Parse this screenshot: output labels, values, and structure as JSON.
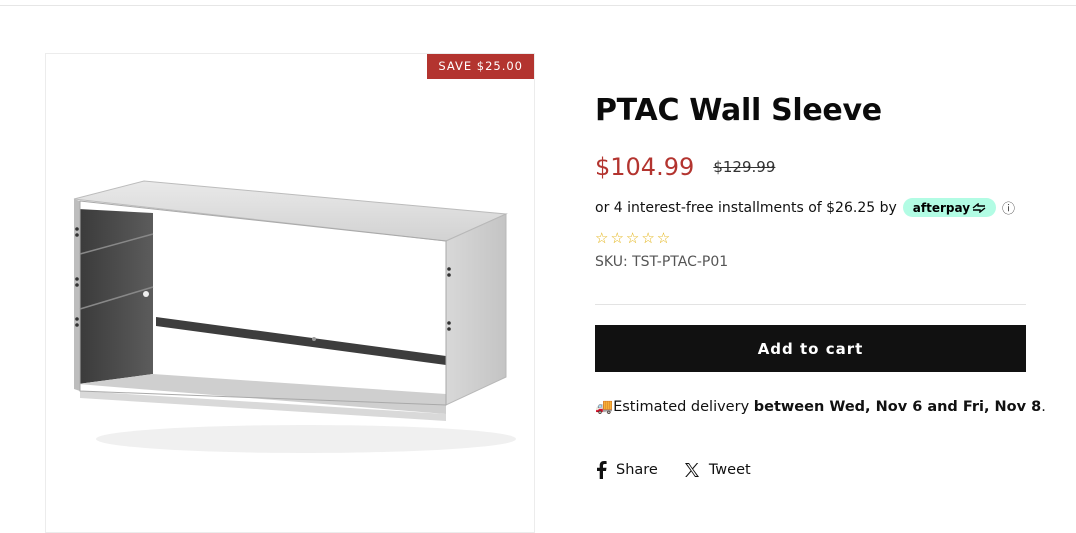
{
  "badge": {
    "save_label": "SAVE $25.00"
  },
  "product": {
    "title": "PTAC Wall Sleeve",
    "price": "$104.99",
    "compare_price": "$129.99",
    "installments_text": "or 4 interest-free installments of $26.25 by",
    "afterpay_label": "afterpay",
    "info_glyph": "ⓘ",
    "stars": "☆☆☆☆☆",
    "sku": "SKU: TST-PTAC-P01",
    "add_to_cart": "Add to cart",
    "delivery_prefix": "Estimated delivery",
    "delivery_range": "between Wed, Nov 6 and Fri, Nov 8",
    "delivery_suffix": ".",
    "delivery_emoji": "🚚",
    "rating_value": 0,
    "rating_max": 5
  },
  "share": {
    "facebook_label": "Share",
    "x_label": "Tweet"
  },
  "colors": {
    "accent": "#b3342f",
    "button": "#111111",
    "afterpay_badge": "#b2fce4",
    "stars": "#e3b313"
  }
}
